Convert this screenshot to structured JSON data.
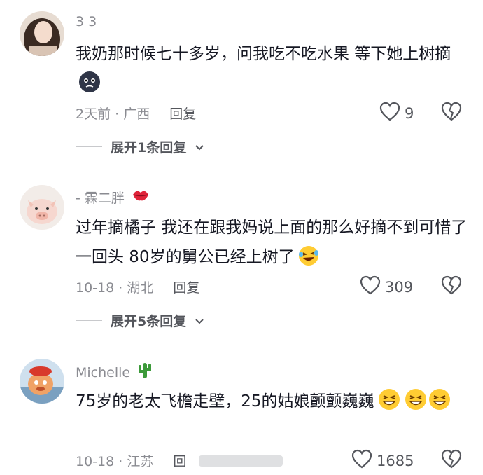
{
  "comments": [
    {
      "username": "3 3",
      "text": "我奶那时候七十多岁，问我吃不吃水果 等下她上树摘",
      "meta": "2天前 · 广西",
      "reply_label": "回复",
      "likes": "9",
      "expand_label": "展开1条回复"
    },
    {
      "username": "- 霖二胖",
      "text": "过年摘橘子 我还在跟我妈说上面的那么好摘不到可惜了  一回头 80岁的舅公已经上树了",
      "meta": "10-18 · 湖北",
      "reply_label": "回复",
      "likes": "309",
      "expand_label": "展开5条回复"
    },
    {
      "username": "Michelle",
      "text": "75岁的老太飞檐走壁，25的姑娘颤颤巍巍",
      "meta": "10-18 · 江苏",
      "reply_label": "回",
      "likes": "1685"
    }
  ],
  "colors": {
    "text": "#161823",
    "secondary": "#8a8b91",
    "heart": "#54565c"
  },
  "icons": [
    "heart-icon",
    "dislike-heart-icon",
    "chevron-down-icon",
    "kiss-lips-icon",
    "cactus-icon"
  ]
}
